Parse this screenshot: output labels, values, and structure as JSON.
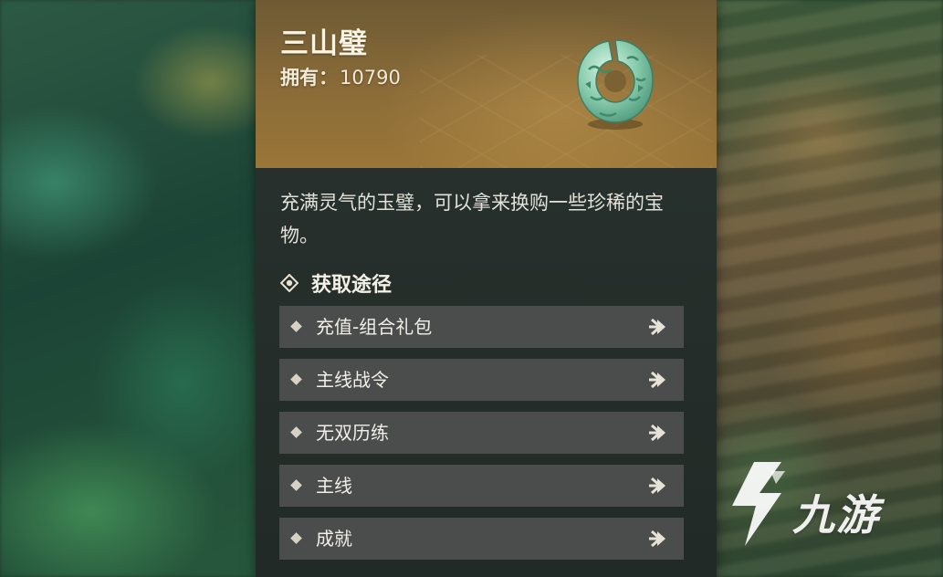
{
  "item": {
    "name": "三山璧",
    "count_label": "拥有：",
    "count_value": "10790",
    "icon": "jade-bi-disc-icon",
    "description": "充满灵气的玉璧，可以拿来换购一些珍稀的宝物。"
  },
  "sources": {
    "title": "获取途径",
    "items": [
      {
        "label": "充值-组合礼包"
      },
      {
        "label": "主线战令"
      },
      {
        "label": "无双历练"
      },
      {
        "label": "主线"
      },
      {
        "label": "成就"
      }
    ]
  },
  "watermark": {
    "text": "九游"
  },
  "colors": {
    "header_gold": "#8b6c38",
    "panel_bg": "#232b28",
    "row_bg": "#4a4d4b",
    "text_light": "#f1efe8"
  }
}
